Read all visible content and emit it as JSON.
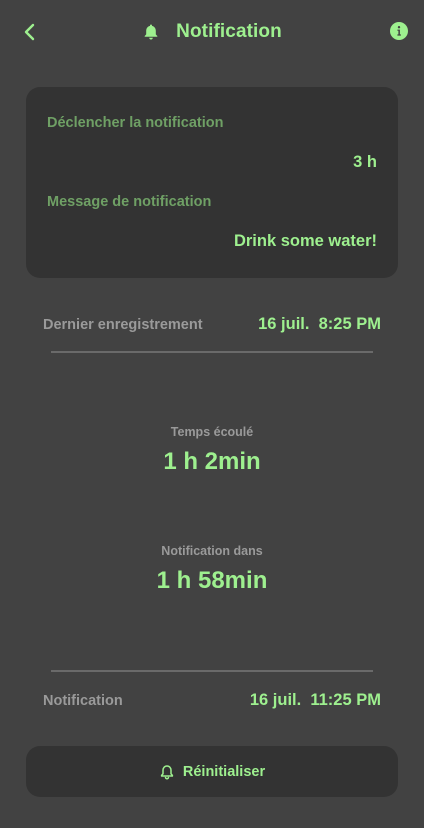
{
  "colors": {
    "background": "#424242",
    "card": "#333333",
    "accent": "#9ef08f",
    "label_muted": "#6fa065",
    "label_gray": "#9a9a9a",
    "divider": "#6a6a6a"
  },
  "header": {
    "title": "Notification",
    "back_icon": "chevron-left-icon",
    "title_icon": "bell-icon",
    "info_icon": "info-icon"
  },
  "settings_card": {
    "trigger_label": "Déclencher la notification",
    "trigger_value": "3 h",
    "message_label": "Message de notification",
    "message_value": "Drink some water!"
  },
  "last_record": {
    "label": "Dernier enregistrement",
    "value": "16 juil.  8:25 PM"
  },
  "elapsed": {
    "label": "Temps écoulé",
    "value": "1 h 2min"
  },
  "notify_in": {
    "label": "Notification dans",
    "value": "1 h 58min"
  },
  "next_notification": {
    "label": "Notification",
    "value": "16 juil.  11:25 PM"
  },
  "reset_button": {
    "label": "Réinitialiser",
    "icon": "bell-outline-icon"
  }
}
